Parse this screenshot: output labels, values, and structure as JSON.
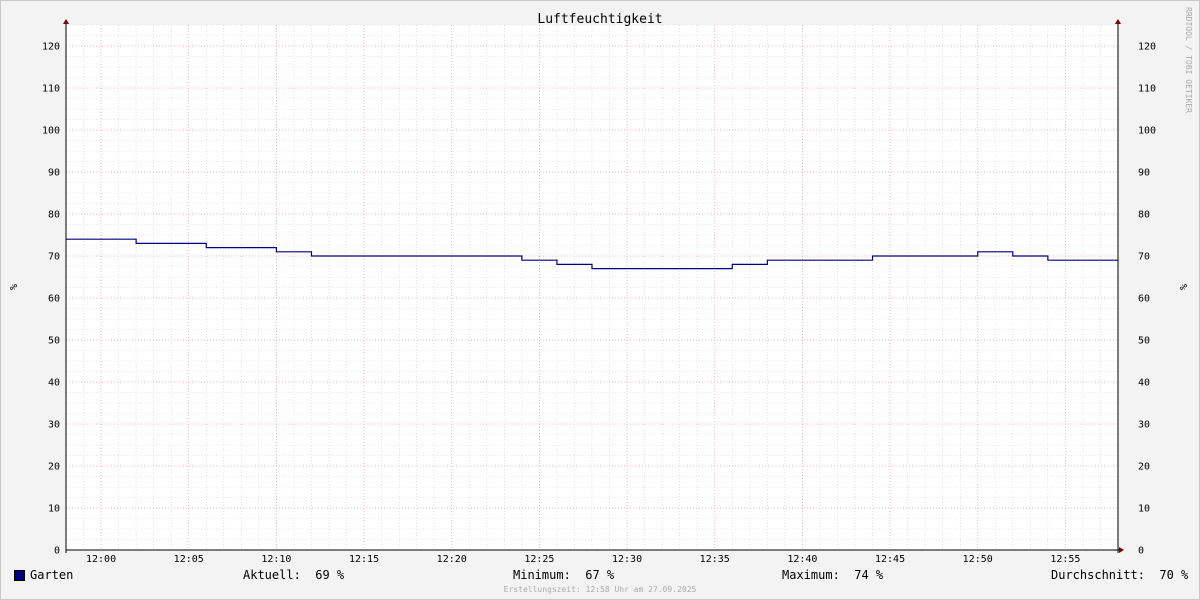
{
  "chart_data": {
    "type": "line",
    "title": "Luftfeuchtigkeit",
    "ylabel": "%",
    "ylabel_right": "%",
    "ylim": [
      0,
      125
    ],
    "yticks": [
      0,
      10,
      20,
      30,
      40,
      50,
      60,
      70,
      80,
      90,
      100,
      110,
      120
    ],
    "xlim": [
      "11:58",
      "12:58"
    ],
    "xticks": [
      "12:00",
      "12:05",
      "12:10",
      "12:15",
      "12:20",
      "12:25",
      "12:30",
      "12:35",
      "12:40",
      "12:45",
      "12:50",
      "12:55"
    ],
    "grid": true,
    "series": [
      {
        "name": "Garten",
        "color": "#000080",
        "step": true,
        "x": [
          "11:58",
          "12:02",
          "12:06",
          "12:10",
          "12:12",
          "12:24",
          "12:26",
          "12:28",
          "12:36",
          "12:38",
          "12:44",
          "12:50",
          "12:52",
          "12:54",
          "12:58"
        ],
        "values": [
          74,
          73,
          72,
          71,
          70,
          69,
          68,
          67,
          68,
          69,
          70,
          71,
          70,
          69,
          69
        ]
      }
    ]
  },
  "legend": {
    "series_name": "Garten",
    "series_color": "#000080",
    "aktuell_label": "Aktuell:",
    "aktuell_value": "69 %",
    "minimum_label": "Minimum:",
    "minimum_value": "67 %",
    "maximum_label": "Maximum:",
    "maximum_value": "74 %",
    "avg_label": "Durchschnitt:",
    "avg_value": "70 %"
  },
  "footer": "Erstellungszeit: 12:58 Uhr am 27.09.2025",
  "watermark": "RRDTOOL / TOBI OETIKER",
  "colors": {
    "major_grid": "#e8a0a8",
    "minor_grid": "#cfcfcf",
    "line": "#000080",
    "axis": "#000000",
    "arrow": "#7a0000"
  }
}
